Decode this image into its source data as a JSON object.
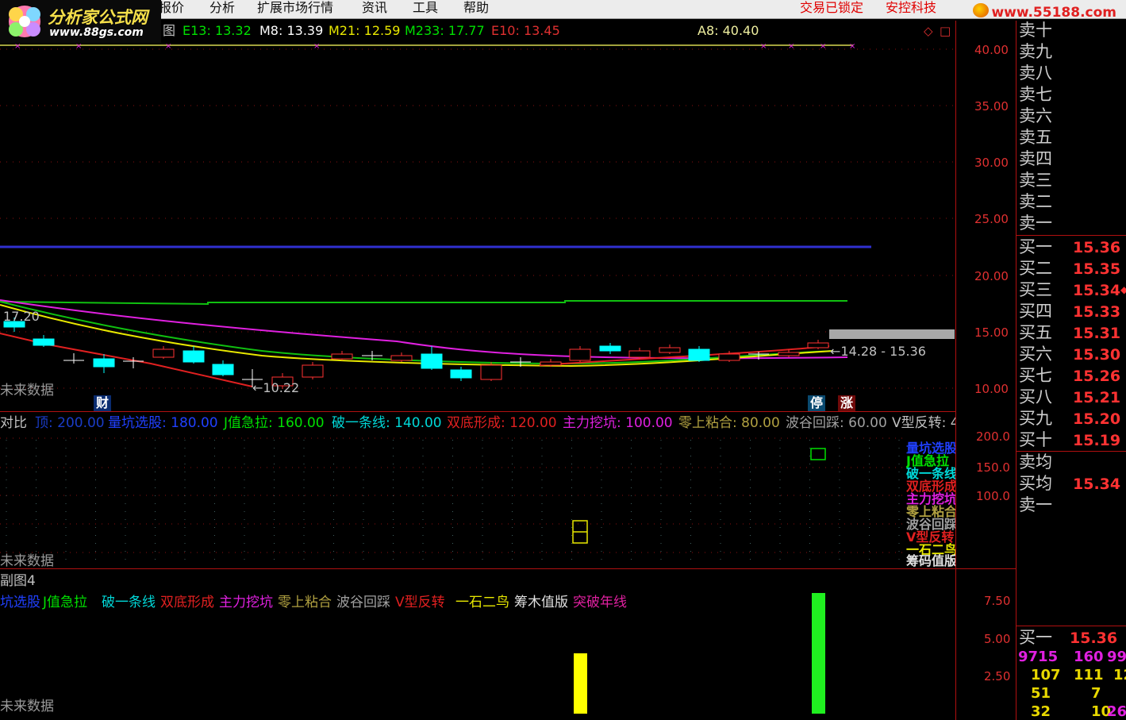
{
  "menu": {
    "items": [
      "报价",
      "分析",
      "扩展市场行情",
      "资讯",
      "工具",
      "帮助"
    ],
    "status_locked": "交易已锁定",
    "status_security": "安控科技",
    "site": "www.55188.com"
  },
  "logo": {
    "title": "分析家公式网",
    "url": "www.88gs.com"
  },
  "main_chart": {
    "title_suffix": "图",
    "indicators": [
      {
        "label": "E13: 13.32",
        "color": "#00e000"
      },
      {
        "label": "M8: 13.39",
        "color": "#ffffff"
      },
      {
        "label": "M21: 12.59",
        "color": "#e8e800"
      },
      {
        "label": "M233: 17.77",
        "color": "#00e000"
      },
      {
        "label": "E10: 13.45",
        "color": "#e03030"
      },
      {
        "label": "A8: 40.40",
        "color": "#f0f0a0"
      }
    ],
    "y_ticks": [
      "40.00",
      "35.00",
      "30.00",
      "25.00",
      "20.00",
      "15.00",
      "10.00"
    ],
    "high_label": "17.20",
    "low_label": "10.22",
    "range_label": "14.28 - 15.36",
    "no_future": "未来数据",
    "tag_finance": "财",
    "tag_stop": "停",
    "tag_rise": "涨"
  },
  "sub1": {
    "title": "对比",
    "legend": [
      {
        "label": "顶: 200.00",
        "color": "#1a3cc8"
      },
      {
        "label": "量坑选股: 180.00",
        "color": "#2040ff"
      },
      {
        "label": "J值急拉: 160.00",
        "color": "#00e000"
      },
      {
        "label": "破一条线: 140.00",
        "color": "#00d8d8"
      },
      {
        "label": "双底形成: 120.00",
        "color": "#e02020"
      },
      {
        "label": "主力挖坑: 100.00",
        "color": "#e020e0"
      },
      {
        "label": "零上粘合: 80.00",
        "color": "#b0a040"
      },
      {
        "label": "波谷回踩: 60.00",
        "color": "#a0a0a0"
      },
      {
        "label": "V型反转: 4",
        "color": "#c0c0c0"
      }
    ],
    "y_ticks": [
      "200.0",
      "150.0",
      "100.0"
    ],
    "right_legend": [
      {
        "label": "量坑选股",
        "color": "#2040ff"
      },
      {
        "label": "J值急拉",
        "color": "#00e000"
      },
      {
        "label": "破一条线",
        "color": "#00d8d8"
      },
      {
        "label": "双底形成",
        "color": "#e02020"
      },
      {
        "label": "主力挖坑",
        "color": "#e020e0"
      },
      {
        "label": "零上粘合",
        "color": "#b0a040"
      },
      {
        "label": "波谷回踩",
        "color": "#a0a0a0"
      },
      {
        "label": "V型反转",
        "color": "#e02020"
      },
      {
        "label": "一石二鸟",
        "color": "#e8e800"
      },
      {
        "label": "筹码值版",
        "color": "#e0e0e0"
      }
    ],
    "no_future": "未来数据"
  },
  "sub2": {
    "title": "副图4",
    "legend": [
      {
        "label": "坑选股",
        "color": "#2040ff"
      },
      {
        "label": "J值急拉",
        "color": "#00e000"
      },
      {
        "label": "破一条线",
        "color": "#00d8d8"
      },
      {
        "label": "双底形成",
        "color": "#e02020"
      },
      {
        "label": "主力挖坑",
        "color": "#e020e0"
      },
      {
        "label": "零上粘合",
        "color": "#b0a040"
      },
      {
        "label": "波谷回踩",
        "color": "#a0a0a0"
      },
      {
        "label": "V型反转",
        "color": "#e02020"
      },
      {
        "label": "一石二鸟",
        "color": "#e8e800"
      },
      {
        "label": "筹木值版",
        "color": "#e0e0e0"
      },
      {
        "label": "突破年线",
        "color": "#e020a0"
      }
    ],
    "y_ticks": [
      "7.50",
      "5.00",
      "2.50"
    ],
    "no_future": "未来数据"
  },
  "orderbook": {
    "sell": [
      {
        "label": "卖十",
        "price": ""
      },
      {
        "label": "卖九",
        "price": ""
      },
      {
        "label": "卖八",
        "price": ""
      },
      {
        "label": "卖七",
        "price": ""
      },
      {
        "label": "卖六",
        "price": ""
      },
      {
        "label": "卖五",
        "price": ""
      },
      {
        "label": "卖四",
        "price": ""
      },
      {
        "label": "卖三",
        "price": ""
      },
      {
        "label": "卖二",
        "price": ""
      },
      {
        "label": "卖一",
        "price": ""
      }
    ],
    "buy": [
      {
        "label": "买一",
        "price": "15.36"
      },
      {
        "label": "买二",
        "price": "15.35"
      },
      {
        "label": "买三",
        "price": "15.34"
      },
      {
        "label": "买四",
        "price": "15.33"
      },
      {
        "label": "买五",
        "price": "15.31"
      },
      {
        "label": "买六",
        "price": "15.30"
      },
      {
        "label": "买七",
        "price": "15.26"
      },
      {
        "label": "买八",
        "price": "15.21"
      },
      {
        "label": "买九",
        "price": "15.20"
      },
      {
        "label": "买十",
        "price": "15.19"
      }
    ],
    "avg_sell": {
      "label": "卖均",
      "price": ""
    },
    "avg_buy": {
      "label": "买均",
      "price": "15.34"
    },
    "sell_one_b": {
      "label": "卖一",
      "price": ""
    },
    "buy_one_b": {
      "label": "买一",
      "price": "15.36"
    },
    "volumes": [
      [
        "9715",
        "160",
        "99"
      ],
      [
        "107",
        "111",
        "12"
      ],
      [
        "51",
        "7",
        ""
      ],
      [
        "32",
        "10",
        "26"
      ]
    ]
  },
  "colors": {
    "up": "#ff3232",
    "down": "#00ffff",
    "axis": "#b01010"
  }
}
